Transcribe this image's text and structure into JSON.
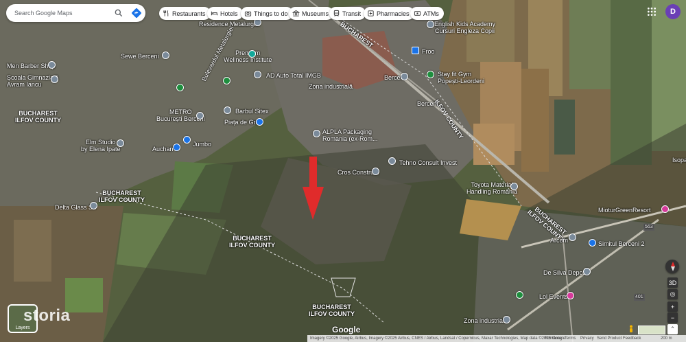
{
  "search": {
    "placeholder": "Search Google Maps"
  },
  "categories": [
    "Restaurants",
    "Hotels",
    "Things to do",
    "Museums",
    "Transit",
    "Pharmacies",
    "ATMs"
  ],
  "account": {
    "initial": "D"
  },
  "labels": {
    "residence": "Residence Metalurgiei",
    "premium": "Premium\nWellness Institute",
    "english": "English Kids Academy\nCursuri Engleza Copii",
    "froo": "Froo",
    "berceni_hall": "Berceni",
    "stayfit": "Stay fit Gym\nPopești-Leordeni",
    "seven": "Sewe Berceni",
    "men_barber": "Men Barber Shop",
    "scoala": "Școala Gimnazială\nAvram Iancu",
    "ad_auto": "AD Auto Total IMGB",
    "zona1": "Zona industrială",
    "berceni_label": "Berceni",
    "bd_metal": "Bulevardul Metalurgiei",
    "bucharest_label": "BUCHAREST",
    "metro": "METRO\nBucurești Berceni",
    "barbul": "Barbul Sitex",
    "piata": "Piața de Gros",
    "ilfov_road": "ILFOV COUNTY",
    "bucharest_road": "BUCHAREST",
    "county_left": "BUCHAREST\nILFOV COUNTY",
    "elm": "Elm Studio\nby Elena Ipate",
    "auchan": "Auchan",
    "jumbo": "Jumbo",
    "alpla": "ALPLA Packaging\nRomania (ex-Rom...",
    "tehno": "Tehno Consult Invest",
    "cros": "Cros Construct",
    "toyota": "Toyota Material\nHandling România",
    "county_mid": "BUCHAREST\nILFOV COUNTY",
    "delta": "Delta Glass Srl",
    "county_mid2": "BUCHAREST\nILFOV COUNTY",
    "county_right": "BUCHAREST\nILFOV COUNTY",
    "isopa": "Isopa",
    "miotur": "MioturGreenResort",
    "road563": "563",
    "arcom": "Arcom",
    "simitul": "Simitul Berceni 2",
    "de_silva": "De Silva Depozit",
    "lol": "Lol Events",
    "zona2": "Zona industrială",
    "county_bottom": "BUCHAREST\nILFOV COUNTY",
    "road401": "401"
  },
  "layers": {
    "label": "Layers"
  },
  "watermark": "storia",
  "controls": {
    "three_d": "3D",
    "zoom_in": "+",
    "zoom_out": "−"
  },
  "google_logo": "Google",
  "footer": {
    "attribution": "Imagery ©2025 Google, Airbus, Imagery ©2025 Airbus, CNES / Airbus, Landsat / Copernicus, Maxar Technologies, Map data ©2025 Google",
    "country": "România",
    "terms": "Terms",
    "privacy": "Privacy",
    "feedback": "Send Product Feedback",
    "scale": "200 m"
  },
  "colors": {
    "marker": "#e02b2b",
    "brand_blue": "#1a73e8",
    "avatar": "#6a3fb5"
  },
  "icons": [
    "search-icon",
    "directions-icon",
    "restaurant-icon",
    "hotel-icon",
    "camera-icon",
    "museum-icon",
    "transit-icon",
    "pharmacy-icon",
    "atm-icon",
    "apps-icon",
    "layers-icon",
    "pegman-icon",
    "compass-icon",
    "location-icon"
  ]
}
